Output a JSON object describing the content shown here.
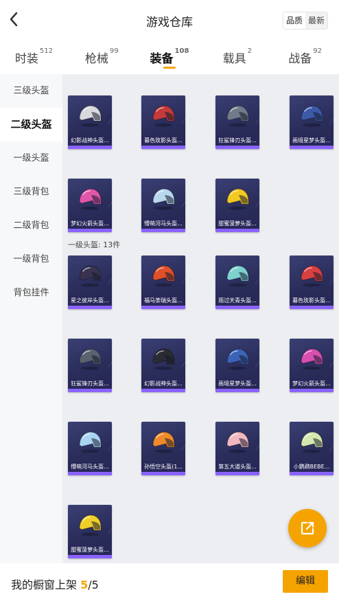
{
  "header": {
    "title": "游戏仓库",
    "sort_quality": "品质",
    "sort_newest": "最新"
  },
  "tabs": [
    {
      "label": "时装",
      "count": "512"
    },
    {
      "label": "枪械",
      "count": "99"
    },
    {
      "label": "装备",
      "count": "108"
    },
    {
      "label": "载具",
      "count": "2"
    },
    {
      "label": "战备",
      "count": "92"
    }
  ],
  "sidebar": [
    {
      "label": "三级头盔"
    },
    {
      "label": "二级头盔"
    },
    {
      "label": "一级头盔"
    },
    {
      "label": "三级背包"
    },
    {
      "label": "二级背包"
    },
    {
      "label": "一级背包"
    },
    {
      "label": "背包挂件"
    }
  ],
  "level2_items": [
    {
      "name": "幻影战神头盔...",
      "color": "#d9d9dd"
    },
    {
      "name": "暮色玫影头盔...",
      "color": "#c23a3a"
    },
    {
      "name": "狂鲨锋刃头盔...",
      "color": "#6f7a8a"
    },
    {
      "name": "画境星梦头盔...",
      "color": "#3d5aa8"
    },
    {
      "name": "梦幻火箭头盔...",
      "color": "#e056a8"
    },
    {
      "name": "懵萌河马头盔...",
      "color": "#b9d8ee"
    },
    {
      "name": "甜蜜菠萝头盔...",
      "color": "#f2c822"
    }
  ],
  "level1_section": {
    "title": "一级头盔: 13件"
  },
  "level1_items": [
    {
      "name": "星之彼岸头盔...",
      "color": "#3a3350"
    },
    {
      "name": "福马荼瑞头盔...",
      "color": "#e0502a"
    },
    {
      "name": "雨过天青头盔...",
      "color": "#7fd1d0"
    },
    {
      "name": "暮色玫影头盔...",
      "color": "#d94040"
    },
    {
      "name": "狂鲨锋刃头盔...",
      "color": "#5a6270"
    },
    {
      "name": "幻影战神头盔...",
      "color": "#2b2b33"
    },
    {
      "name": "画境星梦头盔...",
      "color": "#3b63b7"
    },
    {
      "name": "梦幻火箭头盔...",
      "color": "#d84fb0"
    },
    {
      "name": "懵萌河马头盔...",
      "color": "#a9d4f2"
    },
    {
      "name": "孙悟空头盔(1...",
      "color": "#f08a2a"
    },
    {
      "name": "第五大道头盔...",
      "color": "#f0b8c0"
    },
    {
      "name": "小鹦鹉BEBE...",
      "color": "#d6e8b0"
    },
    {
      "name": "甜蜜菠萝头盔...",
      "color": "#f0cf2a"
    }
  ],
  "footer": {
    "label": "我的橱窗上架",
    "count": "5",
    "total": "/5",
    "edit": "编辑"
  }
}
